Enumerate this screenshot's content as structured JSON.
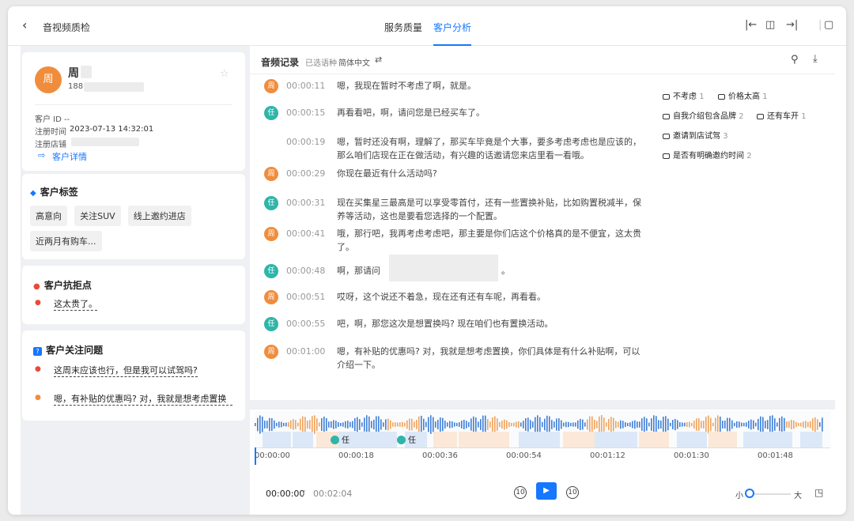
{
  "header": {
    "title": "音视频质检",
    "tabs": [
      "服务质量",
      "客户分析"
    ],
    "active_tab": "客户分析"
  },
  "customer": {
    "avatar_char": "周",
    "name": "周",
    "phone": "188",
    "id_label": "客户 ID --",
    "reg_time_label": "注册时间",
    "reg_time": "2023-07-13 14:32:01",
    "store_label": "注册店铺",
    "detail_link": "客户详情"
  },
  "tags": {
    "title": "客户标签",
    "items": [
      "高意向",
      "关注SUV",
      "线上邀约进店",
      "近两月有购车..."
    ]
  },
  "objections": {
    "title": "客户抗拒点",
    "items": [
      "这太贵了。"
    ]
  },
  "concerns": {
    "title": "客户关注问题",
    "items": [
      "这周末应该也行，但是我可以试驾吗?",
      "嗯，有补贴的优惠吗? 对，我就是想考虑置换"
    ]
  },
  "record": {
    "title": "音频记录",
    "lang_label": "已选语种",
    "lang": "简体中文"
  },
  "messages": [
    {
      "speaker": "周",
      "time": "00:00:11",
      "text": "嗯，我现在暂时不考虑了啊，就是。"
    },
    {
      "speaker": "任",
      "time": "00:00:15",
      "text": "再看看吧，啊，请问您是已经买车了。"
    },
    {
      "speaker": "",
      "time": "00:00:19",
      "text": "嗯，暂时还没有啊，理解了，那买车毕竟是个大事，要多考虑考虑也是应该的，那么咱们店现在正在做活动，有兴趣的话邀请您来店里看一看哦。"
    },
    {
      "speaker": "周",
      "time": "00:00:29",
      "text": "你现在最近有什么活动吗?"
    },
    {
      "speaker": "任",
      "time": "00:00:31",
      "text": "现在买集星三最高是可以享受零首付，还有一些置换补贴，比如购置税减半，保养等活动，这也是要看您选择的一个配置。"
    },
    {
      "speaker": "周",
      "time": "00:00:41",
      "text": "哦，那行吧，我再考虑考虑吧，那主要是你们店这个价格真的是不便宜，这太贵了。"
    },
    {
      "speaker": "任",
      "time": "00:00:48",
      "text": "啊，那请问"
    },
    {
      "speaker": "周",
      "time": "00:00:51",
      "text": "哎呀，这个说还不着急，现在还有还有车呢，再看看。"
    },
    {
      "speaker": "任",
      "time": "00:00:55",
      "text": "吧，啊，那您这次是想置换吗? 现在咱们也有置换活动。"
    },
    {
      "speaker": "周",
      "time": "00:01:00",
      "text": "嗯，有补贴的优惠吗? 对，我就是想考虑置换，你们具体是有什么补贴啊，可以介绍一下。"
    }
  ],
  "keywords": [
    {
      "label": "不考虑",
      "count": "1"
    },
    {
      "label": "价格太高",
      "count": "1"
    },
    {
      "label": "自我介绍包含品牌",
      "count": "2"
    },
    {
      "label": "还有车开",
      "count": "1"
    },
    {
      "label": "邀请到店试驾",
      "count": "3"
    },
    {
      "label": "是否有明确邀约时间",
      "count": "2"
    }
  ],
  "timeline": [
    "00:00:00",
    "00:00:18",
    "00:00:36",
    "00:00:54",
    "00:01:12",
    "00:01:30",
    "00:01:48"
  ],
  "seg_labels": [
    "任",
    "任"
  ],
  "player": {
    "current": "00:00:00",
    "sep": " / ",
    "total": "00:02:04",
    "vol_small": "小",
    "vol_big": "大",
    "skip_back": "10",
    "skip_fwd": "10"
  },
  "colors": {
    "primary": "#1677ff",
    "agent": "#2fb5a9",
    "customer": "#f08d3d"
  }
}
